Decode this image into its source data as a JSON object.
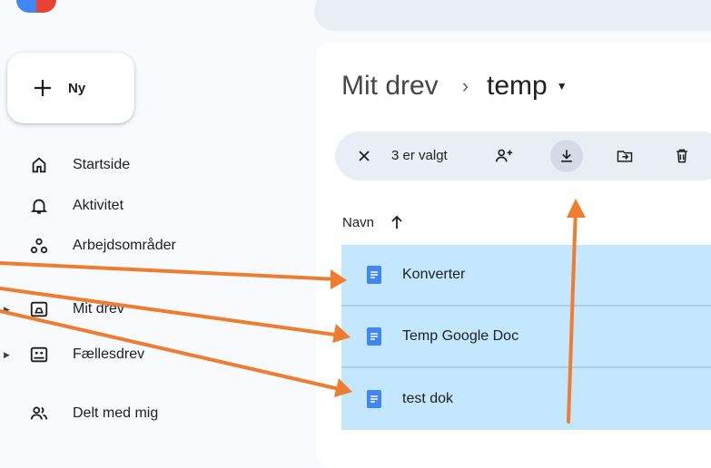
{
  "new_button": {
    "label": "Ny",
    "icon": "plus-icon"
  },
  "sidebar": {
    "items": [
      {
        "label": "Startside",
        "icon": "home-icon"
      },
      {
        "label": "Aktivitet",
        "icon": "bell-icon"
      },
      {
        "label": "Arbejdsområder",
        "icon": "workspaces-icon"
      },
      {
        "label": "Mit drev",
        "icon": "my-drive-icon"
      },
      {
        "label": "Fællesdrev",
        "icon": "shared-drives-icon"
      },
      {
        "label": "Delt med mig",
        "icon": "people-icon"
      }
    ]
  },
  "breadcrumb": {
    "root": "Mit drev",
    "current": "temp"
  },
  "selection_bar": {
    "count_text": "3 er valgt"
  },
  "file_list": {
    "column_name": "Navn",
    "sort": "ascending",
    "files": [
      {
        "name": "Konverter",
        "type": "google-doc"
      },
      {
        "name": "Temp Google Doc",
        "type": "google-doc"
      },
      {
        "name": "test dok",
        "type": "google-doc"
      }
    ]
  },
  "colors": {
    "selected_row": "#c2e7ff",
    "doc_icon": "#4285f4",
    "annotation_arrow": "#ee7d2f",
    "selection_bar": "#e9eef6"
  }
}
